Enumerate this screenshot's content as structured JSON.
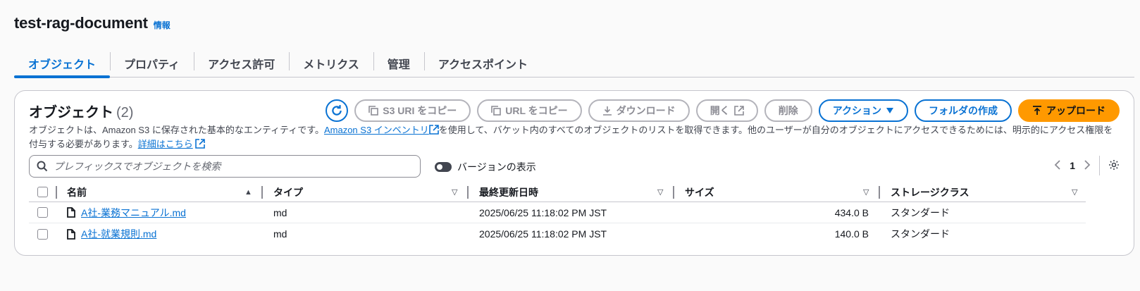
{
  "header": {
    "title": "test-rag-document",
    "info": "情報"
  },
  "tabs": [
    {
      "label": "オブジェクト",
      "active": true
    },
    {
      "label": "プロパティ",
      "active": false
    },
    {
      "label": "アクセス許可",
      "active": false
    },
    {
      "label": "メトリクス",
      "active": false
    },
    {
      "label": "管理",
      "active": false
    },
    {
      "label": "アクセスポイント",
      "active": false
    }
  ],
  "panel": {
    "title": "オブジェクト",
    "count": "(2)",
    "desc_part1": "オブジェクトは、Amazon S3 に保存された基本的なエンティティです。",
    "desc_link1": "Amazon S3 インベントリ",
    "desc_part2": "を使用して、バケット内のすべてのオブジェクトのリストを取得できます。他のユーザーが自分のオブジェクトにアクセスできるためには、明示的にアクセス権限を付与する必要があります。",
    "desc_link2": "詳細はこちら"
  },
  "actions": {
    "copy_s3_uri": "S3 URI をコピー",
    "copy_url": "URL をコピー",
    "download": "ダウンロード",
    "open": "開く",
    "delete": "削除",
    "actions": "アクション",
    "create_folder": "フォルダの作成",
    "upload": "アップロード"
  },
  "search": {
    "placeholder": "プレフィックスでオブジェクトを検索"
  },
  "versions_toggle": {
    "label": "バージョンの表示",
    "on": false
  },
  "pager": {
    "page": "1"
  },
  "table": {
    "columns": [
      "名前",
      "タイプ",
      "最終更新日時",
      "サイズ",
      "ストレージクラス"
    ],
    "rows": [
      {
        "name": "A社-業務マニュアル.md",
        "type": "md",
        "modified": "2025/06/25 11:18:02 PM JST",
        "size": "434.0 B",
        "storage_class": "スタンダード"
      },
      {
        "name": "A社-就業規則.md",
        "type": "md",
        "modified": "2025/06/25 11:18:02 PM JST",
        "size": "140.0 B",
        "storage_class": "スタンダード"
      }
    ]
  },
  "colors": {
    "accent": "#0972d3",
    "upload": "#ff9900"
  }
}
